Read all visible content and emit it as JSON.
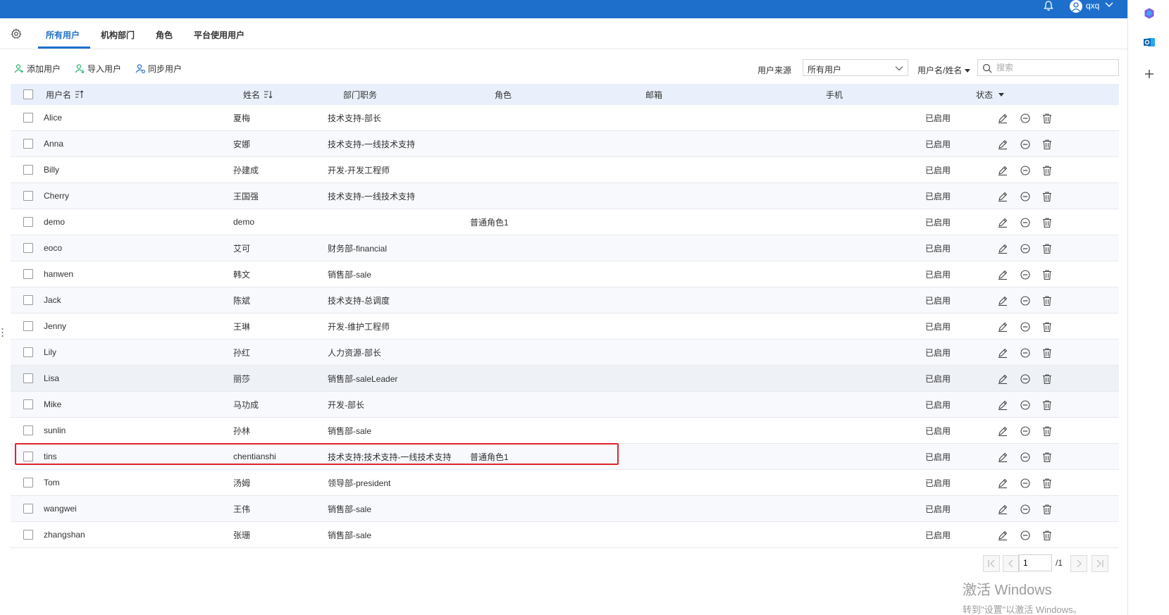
{
  "topbar": {
    "user_name": "qxq",
    "color": "#1e6fcb"
  },
  "tabs": [
    {
      "label": "所有用户",
      "active": true
    },
    {
      "label": "机构部门",
      "active": false
    },
    {
      "label": "角色",
      "active": false
    },
    {
      "label": "平台使用用户",
      "active": false
    }
  ],
  "toolbar": {
    "add_label": "添加用户",
    "import_label": "导入用户",
    "sync_label": "同步用户",
    "source_label": "用户来源",
    "source_value": "所有用户",
    "search_field_label": "用户名/姓名",
    "search_placeholder": "搜索"
  },
  "table": {
    "headers": {
      "username": "用户名",
      "name": "姓名",
      "dept": "部门职务",
      "role": "角色",
      "email": "邮箱",
      "phone": "手机",
      "status": "状态"
    },
    "rows": [
      {
        "username": "Alice",
        "name": "夏梅",
        "dept": "技术支持-部长",
        "role": "",
        "status": "已启用"
      },
      {
        "username": "Anna",
        "name": "安娜",
        "dept": "技术支持-一线技术支持",
        "role": "",
        "status": "已启用"
      },
      {
        "username": "Billy",
        "name": "孙建成",
        "dept": "开发-开发工程师",
        "role": "",
        "status": "已启用"
      },
      {
        "username": "Cherry",
        "name": "王国强",
        "dept": "技术支持-一线技术支持",
        "role": "",
        "status": "已启用"
      },
      {
        "username": "demo",
        "name": "demo",
        "dept": "",
        "role": "普通角色1",
        "status": "已启用"
      },
      {
        "username": "eoco",
        "name": "艾可",
        "dept": "财务部-financial",
        "role": "",
        "status": "已启用"
      },
      {
        "username": "hanwen",
        "name": "韩文",
        "dept": "销售部-sale",
        "role": "",
        "status": "已启用"
      },
      {
        "username": "Jack",
        "name": "陈斌",
        "dept": "技术支持-总调度",
        "role": "",
        "status": "已启用"
      },
      {
        "username": "Jenny",
        "name": "王琳",
        "dept": "开发-维护工程师",
        "role": "",
        "status": "已启用"
      },
      {
        "username": "Lily",
        "name": "孙红",
        "dept": "人力资源-部长",
        "role": "",
        "status": "已启用"
      },
      {
        "username": "Lisa",
        "name": "丽莎",
        "dept": "销售部-saleLeader",
        "role": "",
        "status": "已启用"
      },
      {
        "username": "Mike",
        "name": "马功成",
        "dept": "开发-部长",
        "role": "",
        "status": "已启用"
      },
      {
        "username": "sunlin",
        "name": "孙林",
        "dept": "销售部-sale",
        "role": "",
        "status": "已启用"
      },
      {
        "username": "tins",
        "name": "chentianshi",
        "dept": "技术支持;技术支持-一线技术支持",
        "role": "普通角色1",
        "status": "已启用"
      },
      {
        "username": "Tom",
        "name": "汤姆",
        "dept": "领导部-president",
        "role": "",
        "status": "已启用"
      },
      {
        "username": "wangwei",
        "name": "王伟",
        "dept": "销售部-sale",
        "role": "",
        "status": "已启用"
      },
      {
        "username": "zhangshan",
        "name": "张珊",
        "dept": "销售部-sale",
        "role": "",
        "status": "已启用"
      }
    ],
    "highlight_color": "#e0252b"
  },
  "pagination": {
    "current_page": "1",
    "total_label": "/1"
  },
  "watermark": {
    "line1": "激活 Windows",
    "line2": "转到\"设置\"以激活 Windows。"
  }
}
